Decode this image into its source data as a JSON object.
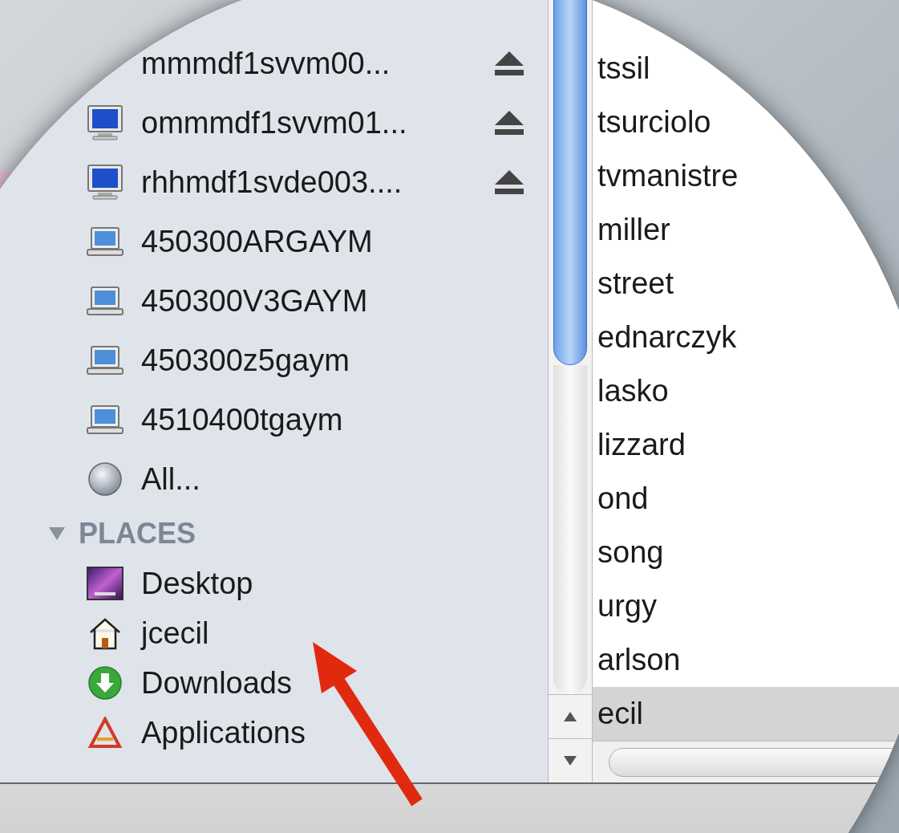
{
  "sidebar": {
    "devices": [
      {
        "name": "mmmdf1svvm00...",
        "kind": "none",
        "eject": true
      },
      {
        "name": "ommmdf1svvm01...",
        "kind": "monitor",
        "eject": true
      },
      {
        "name": "rhhmdf1svde003....",
        "kind": "monitor",
        "eject": true
      },
      {
        "name": "450300ARGAYM",
        "kind": "laptop",
        "eject": false
      },
      {
        "name": "450300V3GAYM",
        "kind": "laptop",
        "eject": false
      },
      {
        "name": "450300z5gaym",
        "kind": "laptop",
        "eject": false
      },
      {
        "name": "4510400tgaym",
        "kind": "laptop",
        "eject": false
      },
      {
        "name": "All...",
        "kind": "globe",
        "eject": false
      }
    ],
    "places": {
      "header": "PLACES",
      "expanded": true,
      "items": [
        {
          "name": "Desktop",
          "kind": "desktop"
        },
        {
          "name": "jcecil",
          "kind": "home"
        },
        {
          "name": "Downloads",
          "kind": "download"
        },
        {
          "name": "Applications",
          "kind": "apps"
        }
      ]
    }
  },
  "file_list": {
    "items": [
      {
        "name": "tssil",
        "selected": false
      },
      {
        "name": "tsurciolo",
        "selected": false
      },
      {
        "name": "tvmanistre",
        "selected": false
      },
      {
        "name": "miller",
        "selected": false
      },
      {
        "name": "street",
        "selected": false
      },
      {
        "name": "ednarczyk",
        "selected": false
      },
      {
        "name": "lasko",
        "selected": false
      },
      {
        "name": "lizzard",
        "selected": false
      },
      {
        "name": "ond",
        "selected": false
      },
      {
        "name": "song",
        "selected": false
      },
      {
        "name": "urgy",
        "selected": false
      },
      {
        "name": "arlson",
        "selected": false
      },
      {
        "name": "ecil",
        "selected": true
      }
    ]
  }
}
